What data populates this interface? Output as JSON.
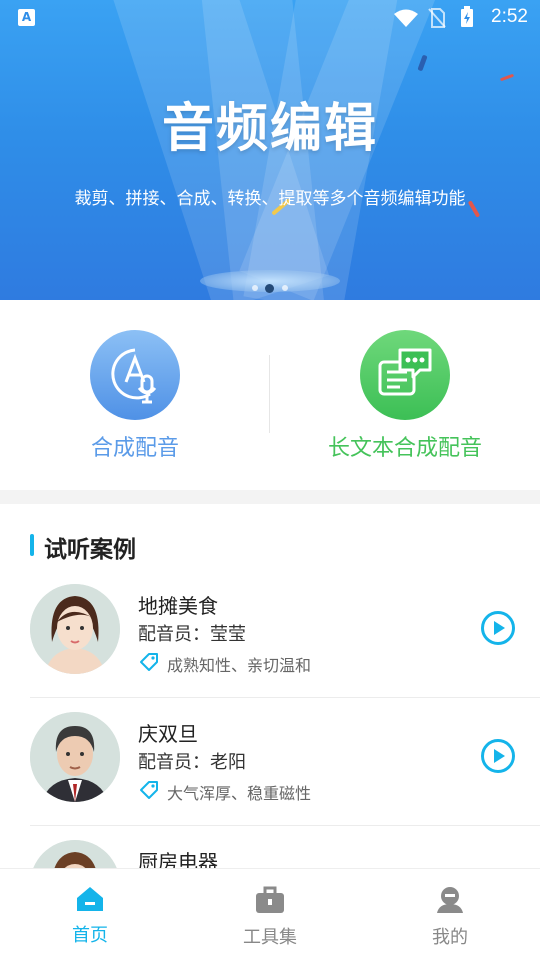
{
  "status": {
    "time": "2:52",
    "app_badge": "A"
  },
  "banner": {
    "title": "音频编辑",
    "subtitle": "裁剪、拼接、合成、转换、提取等多个音频编辑功能",
    "active_slide": 2,
    "slide_count": 3
  },
  "features": [
    {
      "label": "合成配音",
      "icon": "mic-voice-icon",
      "color": "#5b9be8"
    },
    {
      "label": "长文本合成配音",
      "icon": "long-text-chat-icon",
      "color": "#45c35a"
    }
  ],
  "section": {
    "title": "试听案例"
  },
  "cases": [
    {
      "title": "地摊美食",
      "voice": "配音员：莹莹",
      "tags": "成熟知性、亲切温和",
      "avatar": "female-avatar"
    },
    {
      "title": "庆双旦",
      "voice": "配音员：老阳",
      "tags": "大气浑厚、稳重磁性",
      "avatar": "male-avatar"
    },
    {
      "title": "厨房电器",
      "voice": "",
      "tags": "",
      "avatar": "female-avatar-2"
    }
  ],
  "tabs": [
    {
      "label": "首页",
      "icon": "home-icon",
      "active": true
    },
    {
      "label": "工具集",
      "icon": "toolbox-icon",
      "active": false
    },
    {
      "label": "我的",
      "icon": "profile-icon",
      "active": false
    }
  ],
  "colors": {
    "accent": "#14b4ea",
    "blue_text": "#5b9be8",
    "green_text": "#45c35a",
    "tab_inactive": "#888888"
  }
}
